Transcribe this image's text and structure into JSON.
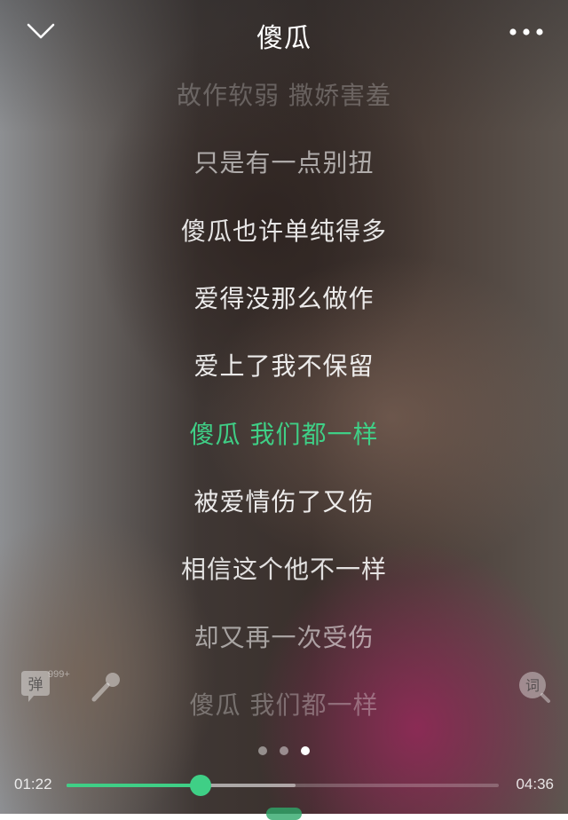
{
  "header": {
    "title": "傻瓜",
    "back_icon": "chevron-down-icon",
    "more_icon": "more-horizontal-icon"
  },
  "lyrics": [
    {
      "text": "故作软弱 撒娇害羞",
      "opacity": 0.25
    },
    {
      "text": "只是有一点别扭",
      "opacity": 0.6
    },
    {
      "text": "傻瓜也许单纯得多",
      "opacity": 0.88
    },
    {
      "text": "爱得没那么做作",
      "opacity": 0.9
    },
    {
      "text": "爱上了我不保留",
      "opacity": 0.9
    },
    {
      "text": "傻瓜 我们都一样",
      "opacity": 1,
      "active": true
    },
    {
      "text": "被爱情伤了又伤",
      "opacity": 0.9
    },
    {
      "text": "相信这个他不一样",
      "opacity": 0.85
    },
    {
      "text": "却又再一次受伤",
      "opacity": 0.55
    },
    {
      "text": "傻瓜 我们都一样",
      "opacity": 0.3
    }
  ],
  "controls": {
    "barrage_label": "弹",
    "barrage_count": "999+",
    "barrage_icon": "barrage-bubble-icon",
    "mic_icon": "microphone-icon",
    "lyric_mode_label": "词",
    "lyric_mode_icon": "lyric-search-icon"
  },
  "pager": {
    "count": 3,
    "active": 2
  },
  "progress": {
    "current": "01:22",
    "total": "04:36",
    "played_fraction": 0.31,
    "buffered_fraction": 0.53
  },
  "colors": {
    "accent": "#3fcf86"
  }
}
